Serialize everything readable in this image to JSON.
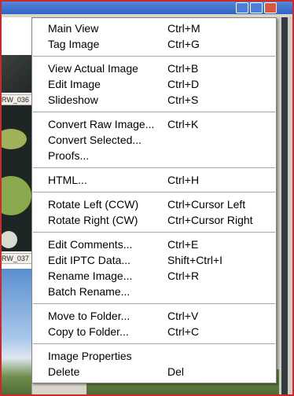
{
  "thumbnails": [
    {
      "label": "RW_036"
    },
    {
      "label": "RW_037"
    }
  ],
  "menu": {
    "groups": [
      [
        {
          "label": "Main View",
          "shortcut": "Ctrl+M"
        },
        {
          "label": "Tag Image",
          "shortcut": "Ctrl+G"
        }
      ],
      [
        {
          "label": "View Actual Image",
          "shortcut": "Ctrl+B"
        },
        {
          "label": "Edit Image",
          "shortcut": "Ctrl+D"
        },
        {
          "label": "Slideshow",
          "shortcut": "Ctrl+S"
        }
      ],
      [
        {
          "label": "Convert Raw Image...",
          "shortcut": "Ctrl+K"
        },
        {
          "label": "Convert Selected...",
          "shortcut": ""
        },
        {
          "label": "Proofs...",
          "shortcut": ""
        }
      ],
      [
        {
          "label": "HTML...",
          "shortcut": "Ctrl+H"
        }
      ],
      [
        {
          "label": "Rotate Left (CCW)",
          "shortcut": "Ctrl+Cursor Left"
        },
        {
          "label": "Rotate Right (CW)",
          "shortcut": "Ctrl+Cursor Right"
        }
      ],
      [
        {
          "label": "Edit Comments...",
          "shortcut": "Ctrl+E"
        },
        {
          "label": "Edit IPTC Data...",
          "shortcut": "Shift+Ctrl+I"
        },
        {
          "label": "Rename Image...",
          "shortcut": "Ctrl+R"
        },
        {
          "label": "Batch Rename...",
          "shortcut": ""
        }
      ],
      [
        {
          "label": "Move to Folder...",
          "shortcut": "Ctrl+V"
        },
        {
          "label": "Copy to Folder...",
          "shortcut": "Ctrl+C"
        }
      ],
      [
        {
          "label": "Image Properties",
          "shortcut": ""
        },
        {
          "label": "Delete",
          "shortcut": "Del"
        }
      ]
    ]
  },
  "colors": {
    "frame": "#cc2a2a",
    "menu_bg": "#ffffff",
    "separator": "#a6a6a6",
    "titlebar": "#2d63c8"
  }
}
